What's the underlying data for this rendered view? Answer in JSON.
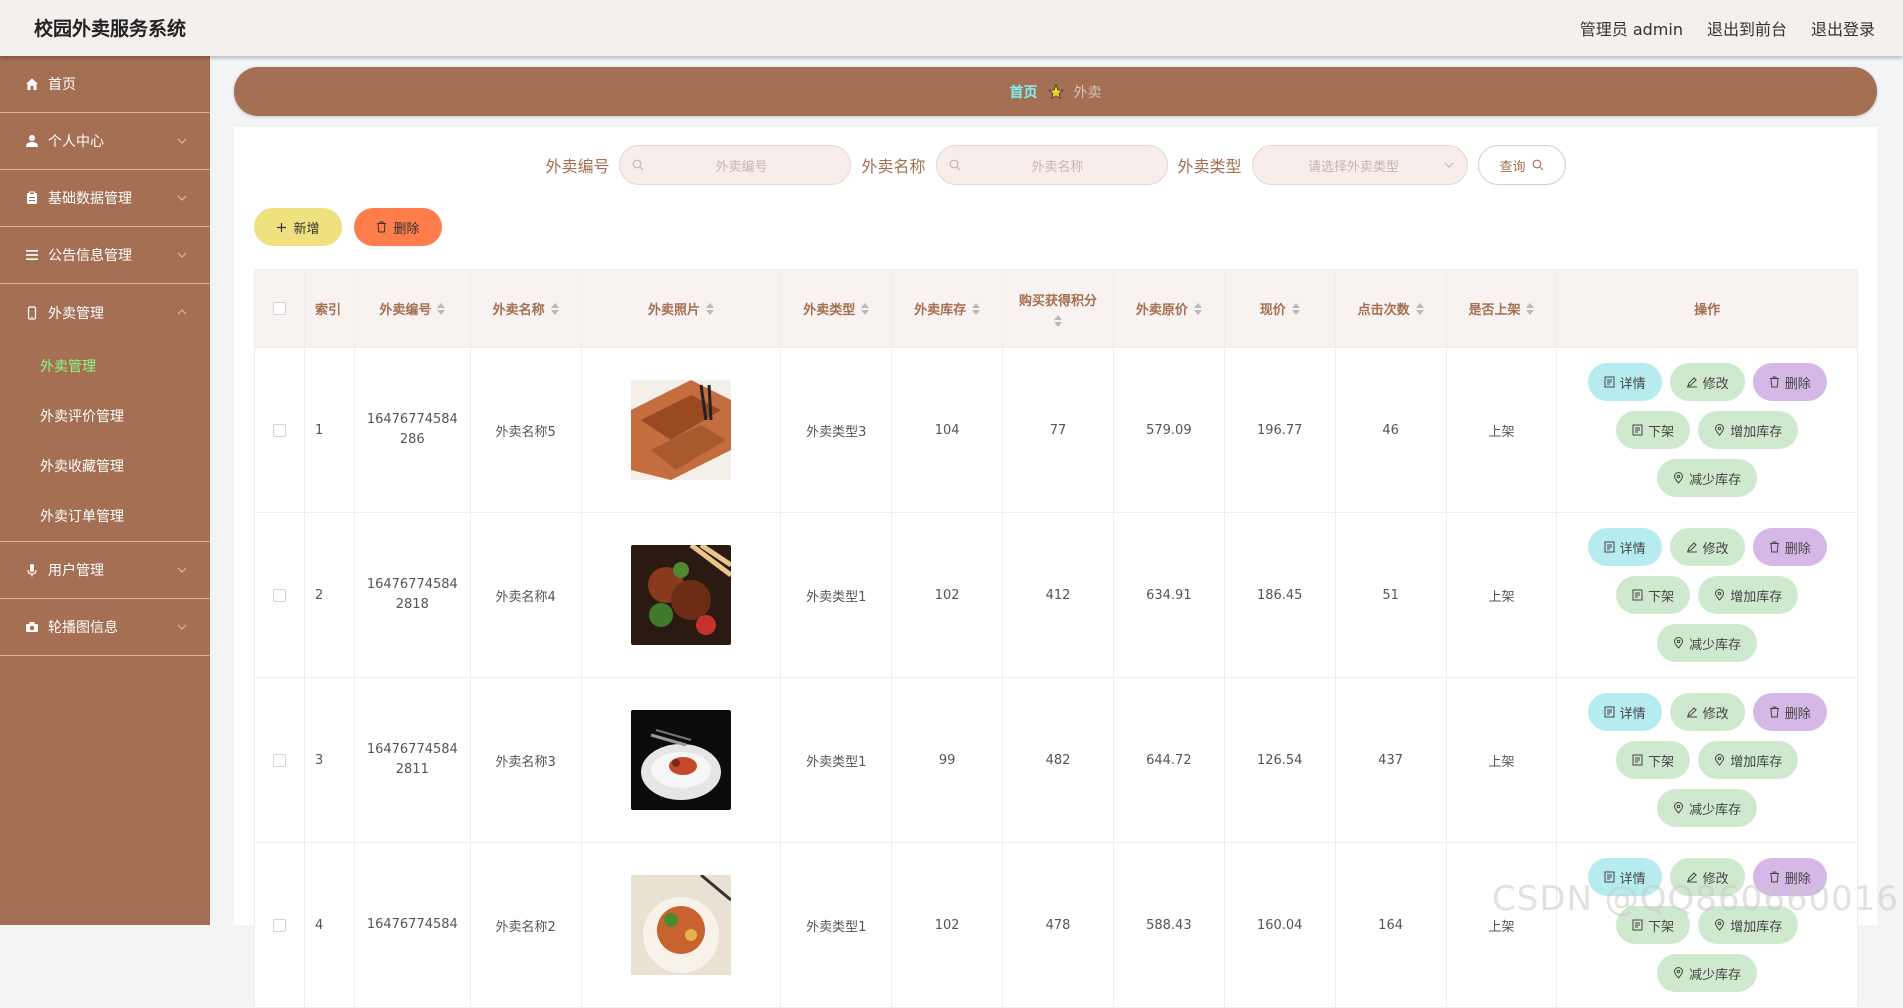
{
  "header": {
    "title": "校园外卖服务系统",
    "admin_label": "管理员 admin",
    "back_front": "退出到前台",
    "logout": "退出登录"
  },
  "sidebar": {
    "items": [
      {
        "label": "首页",
        "icon": "home-icon"
      },
      {
        "label": "个人中心",
        "icon": "user-icon"
      },
      {
        "label": "基础数据管理",
        "icon": "clipboard-icon"
      },
      {
        "label": "公告信息管理",
        "icon": "list-icon"
      },
      {
        "label": "外卖管理",
        "icon": "phone-icon"
      }
    ],
    "sub_items": [
      "外卖管理",
      "外卖评价管理",
      "外卖收藏管理",
      "外卖订单管理"
    ],
    "after_items": [
      {
        "label": "用户管理",
        "icon": "mic-icon"
      },
      {
        "label": "轮播图信息",
        "icon": "camera-icon"
      }
    ]
  },
  "breadcrumb": {
    "home": "首页",
    "current": "外卖"
  },
  "search": {
    "code_label": "外卖编号",
    "code_placeholder": "外卖编号",
    "name_label": "外卖名称",
    "name_placeholder": "外卖名称",
    "type_label": "外卖类型",
    "type_placeholder": "请选择外卖类型",
    "query_label": "查询"
  },
  "actions": {
    "add": "新增",
    "delete": "删除"
  },
  "table": {
    "headers": {
      "index": "索引",
      "code": "外卖编号",
      "name": "外卖名称",
      "photo": "外卖照片",
      "type": "外卖类型",
      "stock": "外卖库存",
      "points": "购买获得积分",
      "orig_price": "外卖原价",
      "price": "现价",
      "clicks": "点击次数",
      "on_shelf": "是否上架",
      "ops": "操作"
    },
    "rows": [
      {
        "index": "1",
        "code": "16476774584286",
        "name": "外卖名称5",
        "type": "外卖类型3",
        "stock": "104",
        "points": "77",
        "orig_price": "579.09",
        "price": "196.77",
        "clicks": "46",
        "on_shelf": "上架"
      },
      {
        "index": "2",
        "code": "164767745842818",
        "name": "外卖名称4",
        "type": "外卖类型1",
        "stock": "102",
        "points": "412",
        "orig_price": "634.91",
        "price": "186.45",
        "clicks": "51",
        "on_shelf": "上架"
      },
      {
        "index": "3",
        "code": "164767745842811",
        "name": "外卖名称3",
        "type": "外卖类型1",
        "stock": "99",
        "points": "482",
        "orig_price": "644.72",
        "price": "126.54",
        "clicks": "437",
        "on_shelf": "上架"
      },
      {
        "index": "4",
        "code": "16476774584",
        "name": "外卖名称2",
        "type": "外卖类型1",
        "stock": "102",
        "points": "478",
        "orig_price": "588.43",
        "price": "160.04",
        "clicks": "164",
        "on_shelf": "上架"
      }
    ],
    "op_labels": {
      "detail": "详情",
      "edit": "修改",
      "delete": "删除",
      "down": "下架",
      "inc": "增加库存",
      "dec": "减少库存"
    }
  },
  "watermark": "CSDN @QQ860660016",
  "colors": {
    "brand": "#a46f53",
    "header_bg": "#f4f0ee",
    "active_submenu": "#8ef98a",
    "add_btn": "#efe080",
    "delete_btn": "#ff7d4a"
  }
}
